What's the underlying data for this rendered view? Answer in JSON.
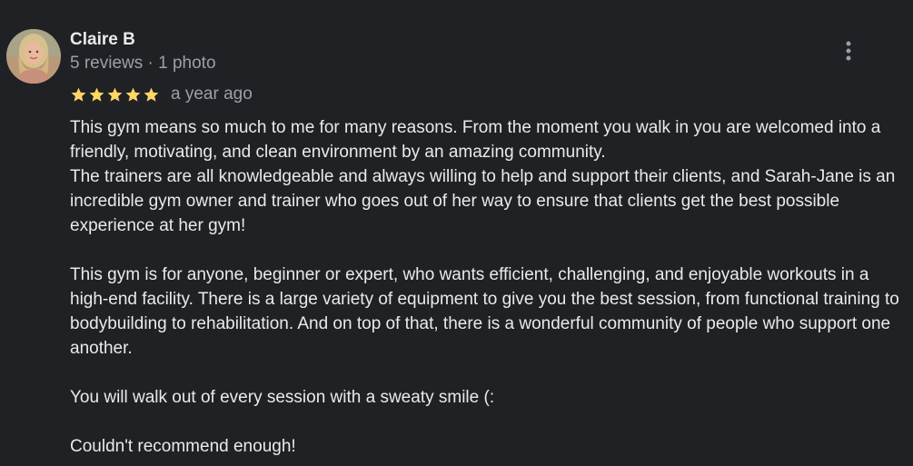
{
  "review": {
    "author": {
      "name": "Claire B",
      "meta": "5 reviews · 1 photo",
      "avatar_icon": "user-avatar-photo"
    },
    "rating": 5,
    "rating_max": 5,
    "star_color": "#fdd663",
    "date": "a year ago",
    "menu_icon": "more-vert-icon",
    "paragraphs": [
      "This gym means so much to me for many reasons. From the moment you walk in you are welcomed into a friendly, motivating, and clean environment by an amazing community.",
      "The trainers are all knowledgeable and always willing to help and support their clients, and Sarah-Jane is an incredible gym owner and trainer who goes out of her way to ensure that clients get the best possible experience at her gym!",
      "This gym is for anyone, beginner or expert, who wants efficient, challenging, and enjoyable workouts in a high-end facility. There is a large variety of equipment to give you the best session, from functional training to bodybuilding to rehabilitation. And on top of that, there is a wonderful community of people who support one another.",
      "You will walk out of every session with a sweaty smile (:",
      "Couldn't recommend enough!"
    ]
  }
}
